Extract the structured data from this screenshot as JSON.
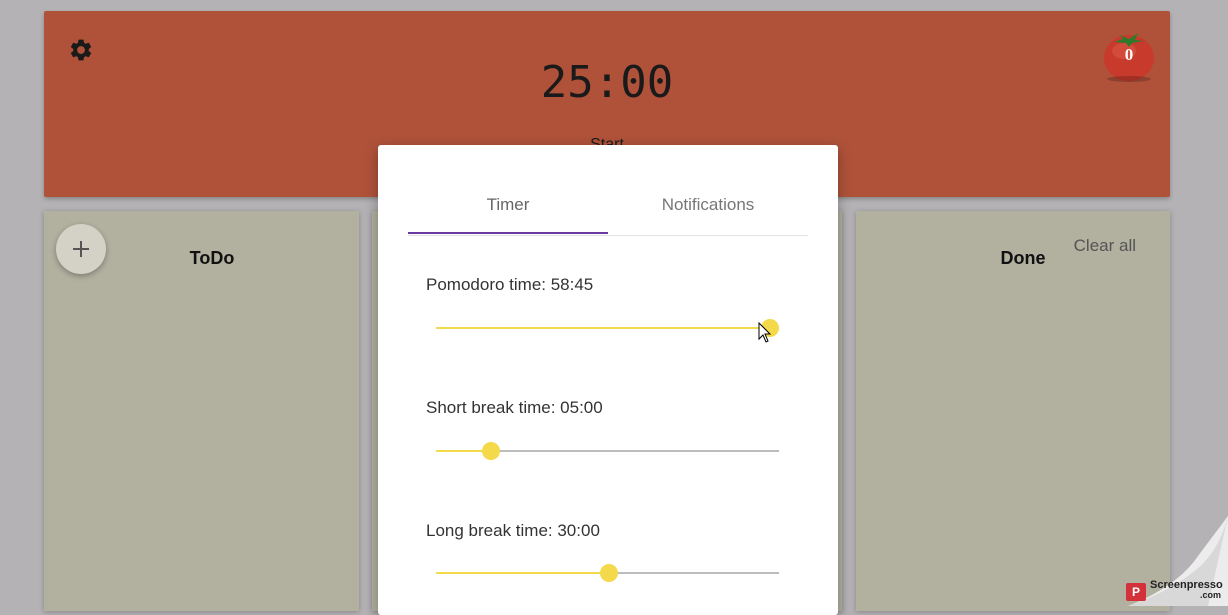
{
  "header": {
    "timer": "25:00",
    "start_label": "Start",
    "pomodoro_count": "0"
  },
  "icons": {
    "settings": "gear-icon",
    "tomato": "tomato-icon",
    "add": "plus-icon"
  },
  "columns": {
    "todo": {
      "title": "ToDo",
      "add_label": "+"
    },
    "done": {
      "title": "Done",
      "clear_label": "Clear all"
    }
  },
  "dialog": {
    "tabs": [
      {
        "label": "Timer",
        "active": true
      },
      {
        "label": "Notifications",
        "active": false
      }
    ],
    "settings": {
      "pomodoro": {
        "label": "Pomodoro time: 58:45",
        "fraction": 0.974
      },
      "short_break": {
        "label": "Short break time: 05:00",
        "fraction": 0.16
      },
      "long_break": {
        "label": "Long break time: 30:00",
        "fraction": 0.505
      }
    }
  },
  "watermark": {
    "line1": "Screenpresso",
    "line2": ".com"
  },
  "colors": {
    "header_bg": "#b0523a",
    "column_bg": "#b2b09f",
    "tab_accent": "#6a3aa0",
    "slider_fill": "#f4d94a"
  }
}
